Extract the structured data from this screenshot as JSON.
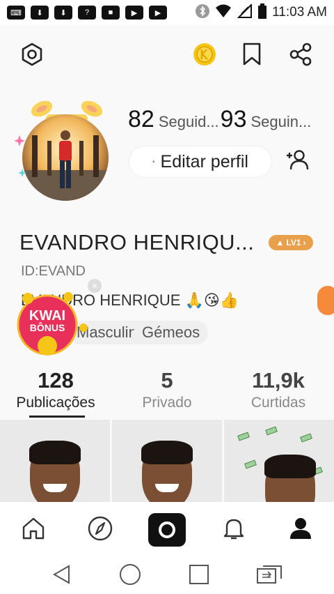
{
  "status_bar": {
    "time": "11:03 AM",
    "left_icons": [
      "keyboard-icon",
      "download-icon",
      "download-icon",
      "qa-icon",
      "video-icon",
      "youtube-icon",
      "youtube-icon"
    ],
    "right_icons": [
      "bluetooth-icon",
      "wifi-icon",
      "signal-icon",
      "battery-icon"
    ]
  },
  "profile": {
    "following_count": "82",
    "following_label": "Seguid...",
    "followers_count": "93",
    "followers_label": "Seguin...",
    "edit_profile_label": "Editar perfil",
    "name": "EVANDRO HENRIQU...",
    "level_badge": "LV1",
    "id": "ID:EVAND",
    "bio": "EVANDRO HENRIQUE 🙏😘👍",
    "tags": [
      "Masculino",
      "Gémeos"
    ]
  },
  "bonus_widget": {
    "line1": "KWAI",
    "line2": "BÔNUS"
  },
  "stats": [
    {
      "value": "128",
      "label": "Publicações",
      "active": true
    },
    {
      "value": "5",
      "label": "Privado",
      "active": false
    },
    {
      "value": "11,9k",
      "label": "Curtidas",
      "active": false
    }
  ],
  "colors": {
    "accent_orange": "#f58a3a",
    "level_badge": "#e8a04a",
    "coin": "#f5c518",
    "bonus_red": "#e8305a"
  }
}
